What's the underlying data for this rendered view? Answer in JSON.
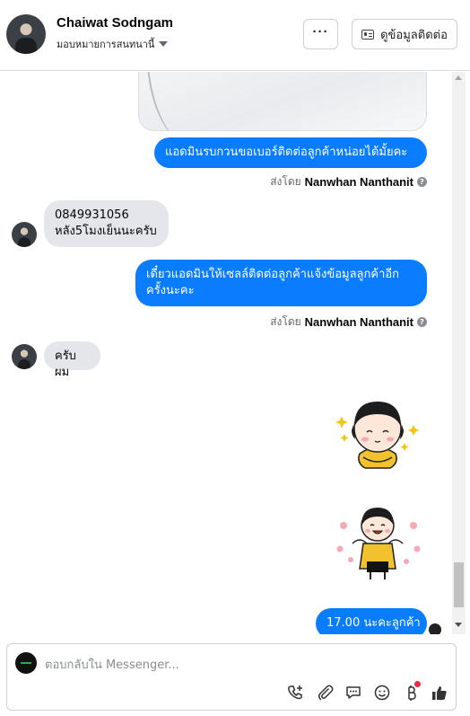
{
  "header": {
    "contact_name": "Chaiwat Sodngam",
    "assignee_label": "มอบหมายการสนทนานี้",
    "more_label": "···",
    "contact_info_label": "ดูข้อมูลติดต่อ"
  },
  "messages": [
    {
      "kind": "outgoing",
      "text": "แอดมินรบกวนขอเบอร์ติดต่อลูกค้าหน่อยได้มั้ยคะ",
      "sent_by_prefix": "ส่งโดย",
      "sent_by": "Nanwhan Nanthanit"
    },
    {
      "kind": "incoming",
      "lines": [
        "0849931056",
        "หลัง5โมงเย็นนะครับ"
      ]
    },
    {
      "kind": "outgoing",
      "lines": [
        "เดี๋ยวแอดมินให้เซลล์ติดต่อลูกค้าแจ้งข้อมูลลูกค้าอีก",
        "ครั้งนะคะ"
      ],
      "sent_by_prefix": "ส่งโดย",
      "sent_by": "Nanwhan Nanthanit"
    },
    {
      "kind": "incoming",
      "text": "ครับผม"
    },
    {
      "kind": "outgoing",
      "text": "17.00 นะคะลูกค้า"
    }
  ],
  "composer": {
    "placeholder": "ตอบกลับใน Messenger..."
  },
  "colors": {
    "outgoing_bubble": "#0a7cff",
    "incoming_bubble": "#e4e6eb",
    "notification_dot": "#f02849"
  },
  "icons": [
    "chevron-down-icon",
    "more-icon",
    "contact-card-icon",
    "help-icon",
    "add-call-icon",
    "attachment-icon",
    "saved-reply-icon",
    "emoji-icon",
    "payment-icon",
    "like-icon"
  ]
}
